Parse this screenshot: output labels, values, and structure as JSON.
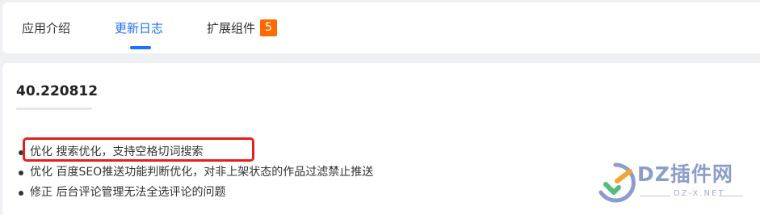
{
  "tabs": {
    "intro": "应用介绍",
    "changelog": "更新日志",
    "extensions": "扩展组件",
    "extensions_badge": "5",
    "active": "changelog"
  },
  "release": {
    "version": "40.220812",
    "items": [
      "优化 搜索优化，支持空格切词搜索",
      "优化 百度SEO推送功能判断优化，对非上架状态的作品过滤禁止推送",
      "修正 后台评论管理无法全选评论的问题"
    ],
    "highlighted_index": 0
  },
  "watermark": {
    "title": "DZ插件网",
    "subtitle": "DZ-X.NET"
  },
  "colors": {
    "accent": "#1e6fff",
    "badge": "#ff6a00",
    "highlight_border": "#e61e1e",
    "watermark": "#7f93c6"
  }
}
